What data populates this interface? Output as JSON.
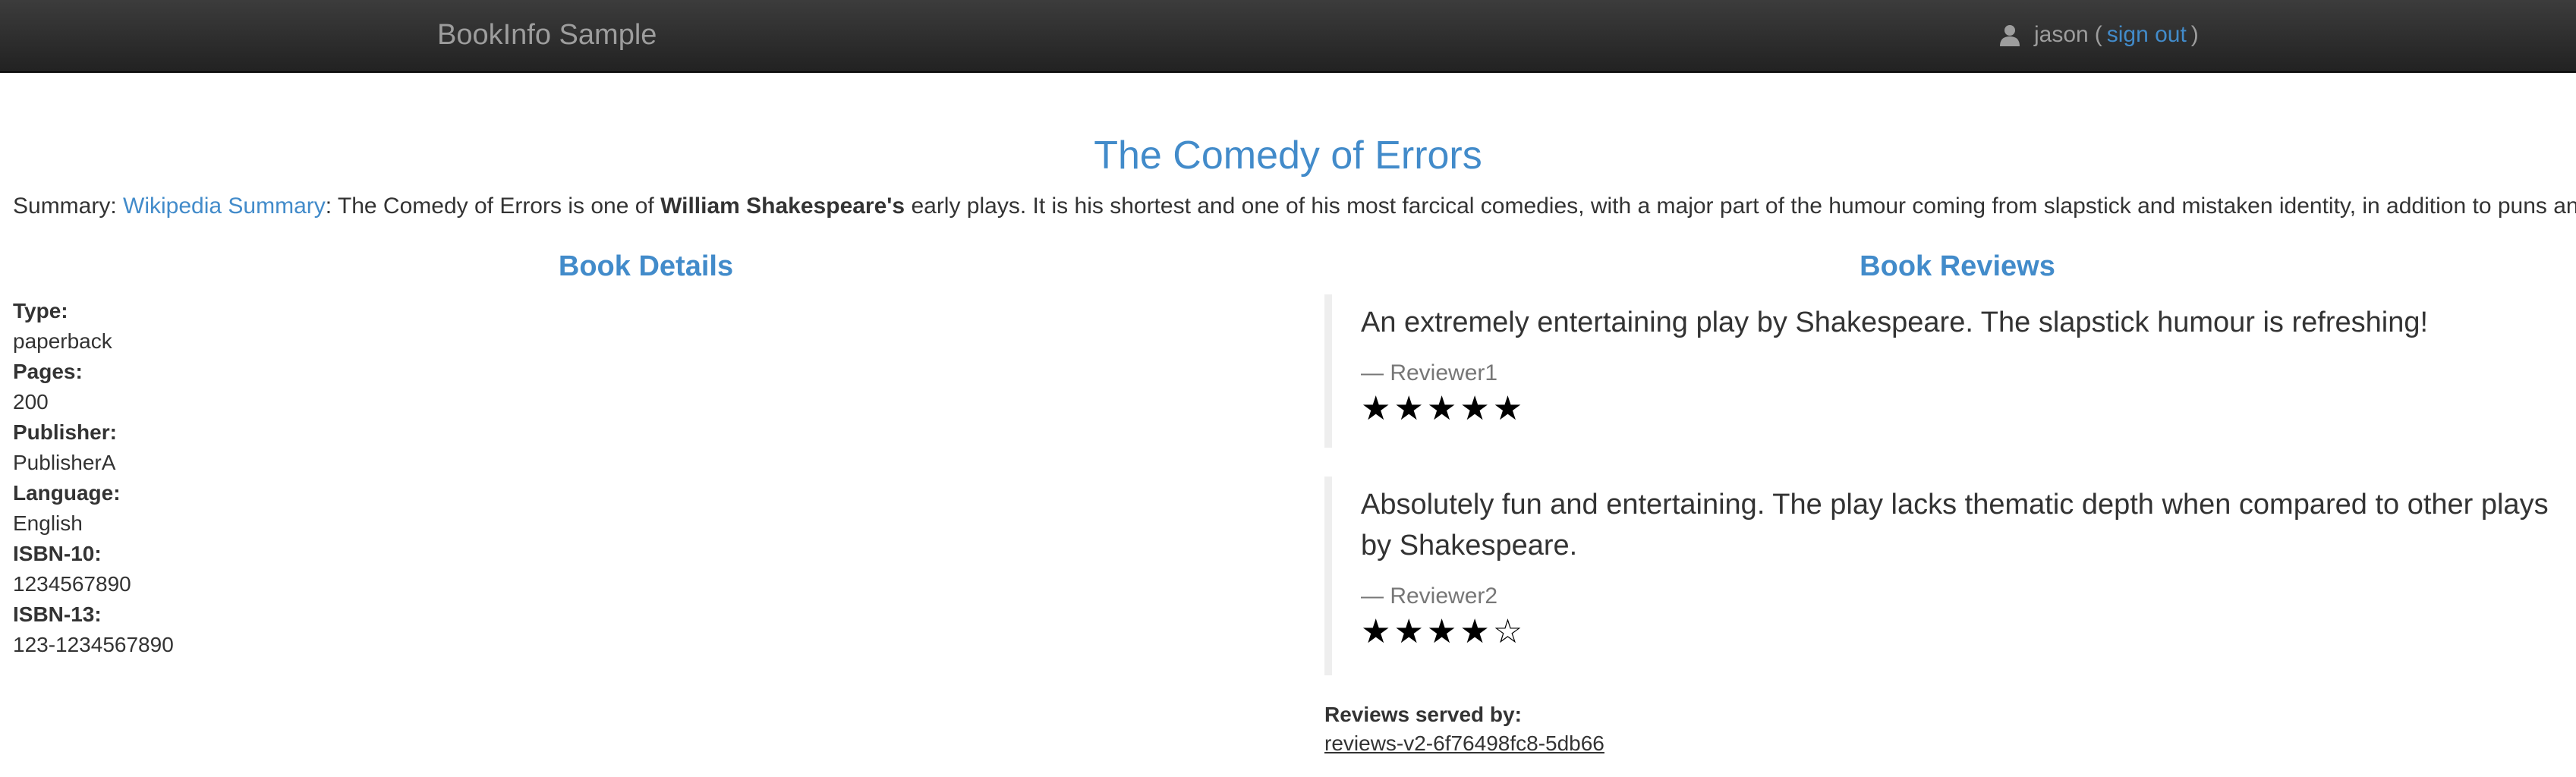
{
  "navbar": {
    "brand": "BookInfo Sample",
    "user": "jason",
    "paren_open": "(",
    "signout_label": "sign out",
    "paren_close": ")"
  },
  "book": {
    "title": "The Comedy of Errors",
    "summary_prefix": "Summary: ",
    "summary_link": "Wikipedia Summary",
    "summary_text_1": ": The Comedy of Errors is one of ",
    "summary_bold": "William Shakespeare's",
    "summary_text_2": " early plays. It is his shortest and one of his most farcical comedies, with a major part of the humour coming from slapstick and mistaken identity, in addition to puns and word play."
  },
  "details": {
    "heading": "Book Details",
    "items": [
      {
        "label": "Type:",
        "value": "paperback"
      },
      {
        "label": "Pages:",
        "value": "200"
      },
      {
        "label": "Publisher:",
        "value": "PublisherA"
      },
      {
        "label": "Language:",
        "value": "English"
      },
      {
        "label": "ISBN-10:",
        "value": "1234567890"
      },
      {
        "label": "ISBN-13:",
        "value": "123-1234567890"
      }
    ]
  },
  "reviews": {
    "heading": "Book Reviews",
    "items": [
      {
        "text": "An extremely entertaining play by Shakespeare. The slapstick humour is refreshing!",
        "reviewer": "— Reviewer1",
        "stars": "★★★★★",
        "rating": 5
      },
      {
        "text": "Absolutely fun and entertaining. The play lacks thematic depth when compared to other plays by Shakespeare.",
        "reviewer": "— Reviewer2",
        "stars": "★★★★☆",
        "rating": 4
      }
    ],
    "served_by_label": "Reviews served by:",
    "served_by_value": "reviews-v2-6f76498fc8-5db66"
  },
  "colors": {
    "accent": "#428bca",
    "navbar": "#222222",
    "muted": "#777777"
  }
}
